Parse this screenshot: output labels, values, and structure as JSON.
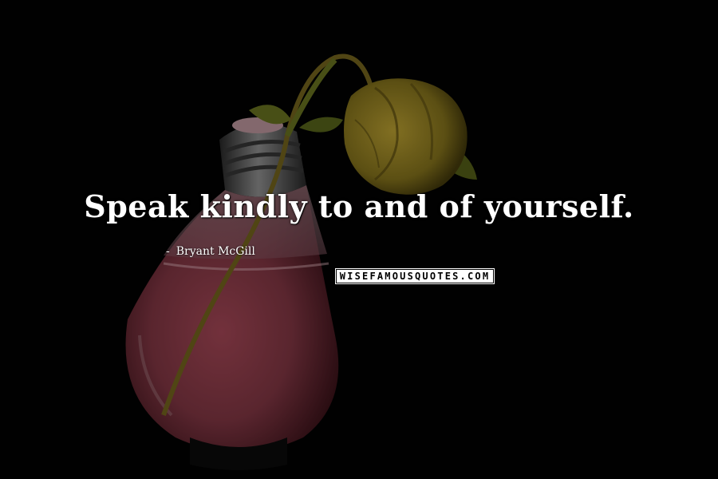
{
  "quote": {
    "text": "Speak kindly to and of yourself."
  },
  "author": {
    "dash": "-",
    "name": "Bryant McGill"
  },
  "watermark": {
    "text": "WISEFAMOUSQUOTES.COM"
  },
  "colors": {
    "background": "#020202",
    "bulb_liquid": "#8a3a48",
    "bulb_base": "#6e6e6e",
    "rose": "#b39a2a",
    "stem": "#6f7a22",
    "quote_text": "#ffffff",
    "badge_bg": "#ffffff"
  },
  "scene": {
    "objects": [
      "light-bulb-vase",
      "wilted-yellow-rose"
    ]
  }
}
